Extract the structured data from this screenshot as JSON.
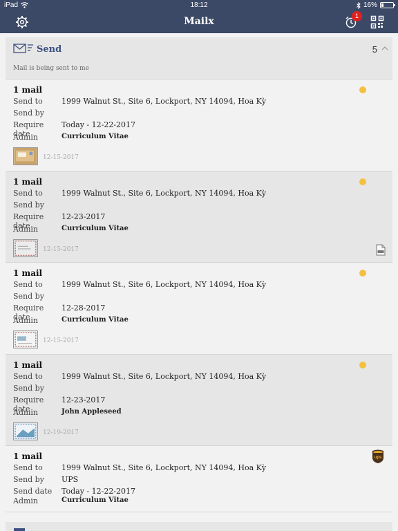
{
  "status": {
    "device": "iPad",
    "time": "18:12",
    "battery_text": "16%",
    "battery_level": 0.16
  },
  "nav": {
    "title": "Mailx",
    "notification_count": "1"
  },
  "section": {
    "title": "Send",
    "count": "5",
    "subtitle": "Mail is being sent to me"
  },
  "cards": [
    {
      "mail_count": "1 mail",
      "send_to_label": "Send to",
      "send_to": "1999 Walnut St., Site 6, Lockport, NY 14094, Hoa Kỳ",
      "send_by_label": "Send by",
      "send_by": "",
      "date_label": "Require date",
      "date": "Today - 12-22-2017",
      "admin_label": "Admin",
      "admin": "Curriculum Vitae",
      "thumb_date": "12-15-2017",
      "status_color": "#f5c040"
    },
    {
      "mail_count": "1 mail",
      "send_to_label": "Send to",
      "send_to": "1999 Walnut St., Site 6, Lockport, NY 14094, Hoa Kỳ",
      "send_by_label": "Send by",
      "send_by": "",
      "date_label": "Require date",
      "date": "12-23-2017",
      "admin_label": "Admin",
      "admin": "Curriculum Vitae",
      "thumb_date": "12-15-2017",
      "status_color": "#f5c040",
      "attachment_icon": "pdf-icon"
    },
    {
      "mail_count": "1 mail",
      "send_to_label": "Send to",
      "send_to": "1999 Walnut St., Site 6, Lockport, NY 14094, Hoa Kỳ",
      "send_by_label": "Send by",
      "send_by": "",
      "date_label": "Require date",
      "date": "12-28-2017",
      "admin_label": "Admin",
      "admin": "Curriculum Vitae",
      "thumb_date": "12-15-2017",
      "status_color": "#f5c040"
    },
    {
      "mail_count": "1 mail",
      "send_to_label": "Send to",
      "send_to": "1999 Walnut St., Site 6, Lockport, NY 14094, Hoa Kỳ",
      "send_by_label": "Send by",
      "send_by": "",
      "date_label": "Require date",
      "date": "12-23-2017",
      "admin_label": "Admin",
      "admin": "John Appleseed",
      "thumb_date": "12-19-2017",
      "status_color": "#f5c040"
    },
    {
      "mail_count": "1 mail",
      "send_to_label": "Send to",
      "send_to": "1999 Walnut St., Site 6, Lockport, NY 14094, Hoa Kỳ",
      "send_by_label": "Send by",
      "send_by": "UPS",
      "date_label": "Send date",
      "date": "Today - 12-22-2017",
      "admin_label": "Admin",
      "admin": "Curriculum Vitae",
      "carrier_icon": "ups-icon"
    }
  ],
  "colors": {
    "nav_bg": "#3c4966",
    "accent": "#3c5080",
    "status_dot": "#f5c040"
  }
}
